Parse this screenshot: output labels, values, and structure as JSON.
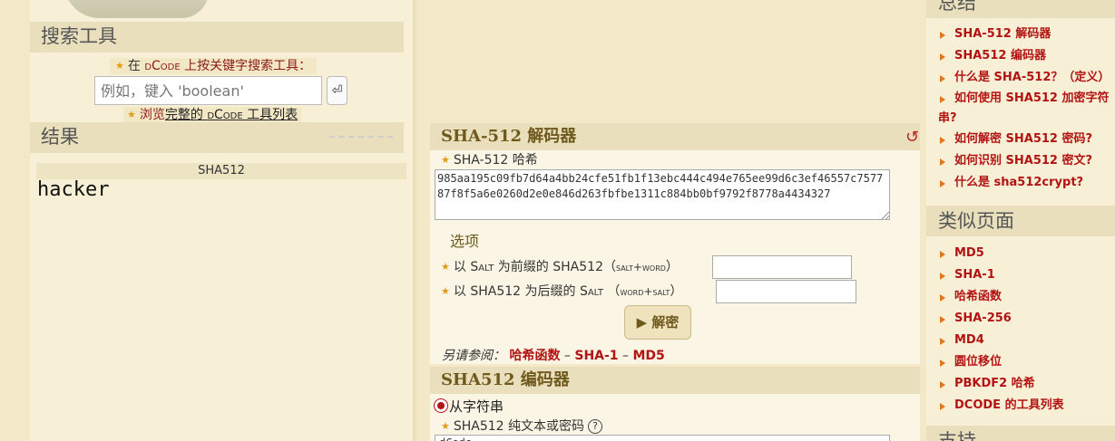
{
  "left": {
    "search_header": "搜索工具",
    "search_prompt": {
      "before": "在 ",
      "brand": "dCode",
      "after": " 上按关键字搜索工具："
    },
    "search_placeholder": "例如，键入 'boolean'",
    "search_go_icon": "enter-icon",
    "browse": {
      "before": "浏览",
      "full": "完整",
      "mid": "的 ",
      "brand": "dCode",
      "after": " 工具列表"
    },
    "results_header": "结果",
    "result_label": "SHA512",
    "result_value": "hacker"
  },
  "decoder": {
    "title": "SHA-512 解码器",
    "hash_label": "SHA-512 哈希",
    "hash_value": "985aa195c09fb7d64a4bb24cfe51fb1f13ebc444c494e765ee99d6c3ef46557c757787f8f5a6e0260d2e0e846d263fbfbe1311c884bb0bf9792f8778a4434327",
    "options_title": "选项",
    "salt_prefix_label_a": "以 ",
    "salt_prefix_label_salt": "Salt",
    "salt_prefix_label_b": " 为前缀的 SHA512（",
    "salt_prefix_label_hint": "salt+word",
    "salt_prefix_label_c": "）",
    "salt_suffix_label_a": "以 SHA512 为后缀的 ",
    "salt_suffix_label_salt": "Salt",
    "salt_suffix_label_b": " （",
    "salt_suffix_label_hint": "word+salt",
    "salt_suffix_label_c": "）",
    "decrypt_button": "▶ 解密",
    "see_also_label": "另请参阅：",
    "see_also_links": [
      "哈希函数",
      "SHA-1",
      "MD5"
    ],
    "see_also_sep": " – "
  },
  "encoder": {
    "title": "SHA512 编码器",
    "from_string_label": "从字符串",
    "plaintext_label": "SHA512 纯文本或密码",
    "plaintext_value": "dCode"
  },
  "right": {
    "summary_header": "总结",
    "summary_items": [
      "SHA-512 解码器",
      "SHA512 编码器",
      "什么是 SHA-512？（定义）",
      "如何使用 SHA512 加密字符串?",
      "如何解密 SHA512 密码?",
      "如何识别 SHA512 密文?",
      "什么是 sha512crypt?"
    ],
    "similar_header": "类似页面",
    "similar_items": [
      "MD5",
      "SHA-1",
      "哈希函数",
      "SHA-256",
      "MD4",
      "圆位移位",
      "PBKDF2 哈希",
      "DCODE 的工具列表"
    ],
    "support_header": "支持"
  }
}
